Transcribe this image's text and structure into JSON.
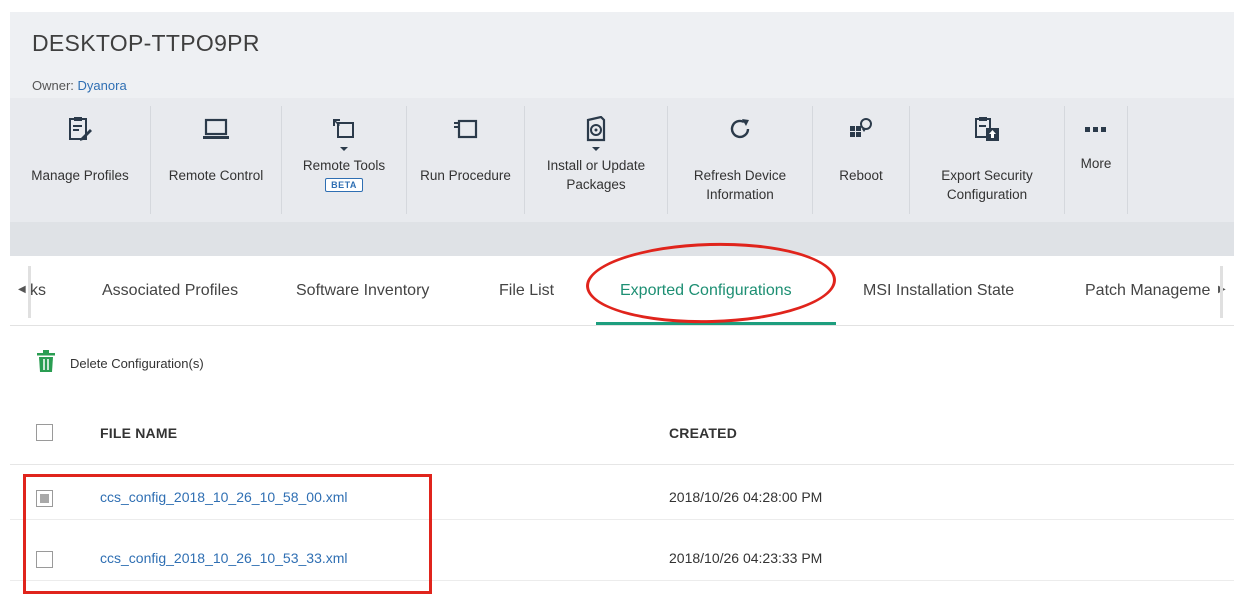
{
  "device": {
    "name": "DESKTOP-TTPO9PR",
    "owner_label": "Owner:",
    "owner_name": "Dyanora"
  },
  "toolbar": {
    "buttons": [
      {
        "id": "manage-profiles",
        "label": "Manage Profiles",
        "icon": "clipboard-edit-icon"
      },
      {
        "id": "remote-control",
        "label": "Remote Control",
        "icon": "laptop-icon"
      },
      {
        "id": "remote-tools",
        "label": "Remote Tools",
        "badge": "BETA",
        "icon": "remote-tools-icon",
        "dropdown": true
      },
      {
        "id": "run-procedure",
        "label": "Run Procedure",
        "icon": "run-procedure-icon"
      },
      {
        "id": "install-update",
        "label": "Install or Update\nPackages",
        "icon": "package-disc-icon",
        "dropdown": true
      },
      {
        "id": "refresh-device",
        "label": "Refresh Device\nInformation",
        "icon": "refresh-icon"
      },
      {
        "id": "reboot",
        "label": "Reboot",
        "icon": "reboot-icon"
      },
      {
        "id": "export-security",
        "label": "Export Security\nConfiguration",
        "icon": "export-config-icon"
      },
      {
        "id": "more",
        "label": "More",
        "icon": "more-dots-icon"
      }
    ]
  },
  "tabs": {
    "items": [
      {
        "label": "ks"
      },
      {
        "label": "Associated Profiles"
      },
      {
        "label": "Software Inventory"
      },
      {
        "label": "File List"
      },
      {
        "label": "Exported Configurations",
        "active": true
      },
      {
        "label": "MSI Installation State"
      },
      {
        "label": "Patch Manageme"
      }
    ]
  },
  "actions": {
    "delete_label": "Delete Configuration(s)"
  },
  "table": {
    "columns": [
      "FILE NAME",
      "CREATED"
    ],
    "rows": [
      {
        "file_name": "ccs_config_2018_10_26_10_58_00.xml",
        "created": "2018/10/26 04:28:00 PM",
        "checked": "partial"
      },
      {
        "file_name": "ccs_config_2018_10_26_10_53_33.xml",
        "created": "2018/10/26 04:23:33 PM",
        "checked": false
      }
    ]
  },
  "colors": {
    "accent": "#1d9e7e",
    "link": "#2f6fb3",
    "highlight": "#e0241c",
    "trash": "#2a9d52"
  }
}
